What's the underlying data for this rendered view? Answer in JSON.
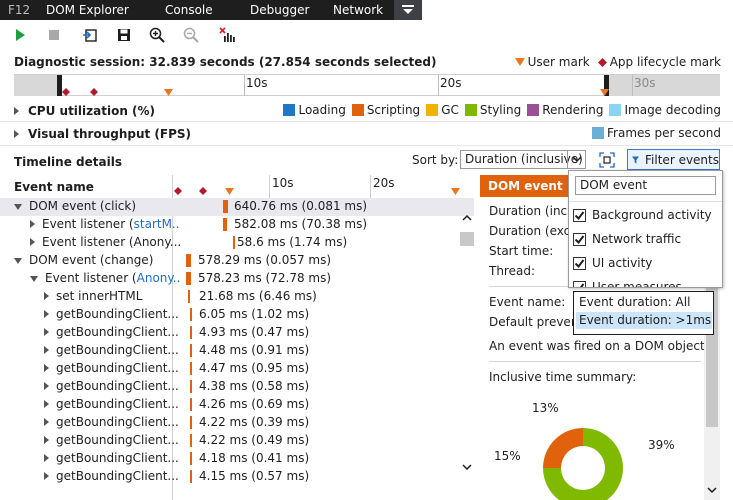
{
  "tabs": {
    "f12": "F12",
    "items": [
      "DOM Explorer",
      "Console",
      "Debugger",
      "Network"
    ]
  },
  "toolbar": {
    "icons": [
      "play-icon",
      "stop-icon",
      "import-icon",
      "save-icon",
      "zoom-in-icon",
      "zoom-out-icon",
      "clear-selection-icon"
    ]
  },
  "session": {
    "text": "Diagnostic session: 32.839 seconds (27.854 seconds selected)",
    "user_mark": "User mark",
    "lifecycle_mark": "App lifecycle mark"
  },
  "overview_ruler": {
    "labels": [
      "10s",
      "20s",
      "30s"
    ]
  },
  "cpu": {
    "title": "CPU utilization (%)",
    "legend": [
      {
        "label": "Loading",
        "color": "#1e78c8"
      },
      {
        "label": "Scripting",
        "color": "#e0620d"
      },
      {
        "label": "GC",
        "color": "#f0b400"
      },
      {
        "label": "Styling",
        "color": "#7fba00"
      },
      {
        "label": "Rendering",
        "color": "#9b4f96"
      },
      {
        "label": "Image decoding",
        "color": "#8cd3f0"
      }
    ]
  },
  "visual": {
    "title": "Visual throughput (FPS)",
    "legend": "Frames per second"
  },
  "details": {
    "title": "Timeline details",
    "sort_label": "Sort by:",
    "sort_value": "Duration (inclusive)",
    "filter_label": "Filter events"
  },
  "list": {
    "header": "Event name",
    "ruler_labels": [
      "10s",
      "20s"
    ],
    "rows": [
      {
        "name": "DOM event (click)",
        "value": "640.76 ms (0.081 ms)"
      },
      {
        "name": "Event listener (",
        "link": "startM...",
        "value": "582.08 ms (70.38 ms)"
      },
      {
        "name": "Event listener (Anony...",
        "value": "58.6 ms (1.74 ms)"
      },
      {
        "name": "DOM event (change)",
        "value": "578.29 ms (0.057 ms)"
      },
      {
        "name": "Event listener (",
        "link": "Anony...",
        "value": "578.23 ms (72.78 ms)"
      },
      {
        "name": "set innerHTML",
        "value": "21.68 ms (6.46 ms)"
      },
      {
        "name": "getBoundingClient...",
        "value": "6.05 ms (1.02 ms)"
      },
      {
        "name": "getBoundingClient...",
        "value": "4.93 ms (0.47 ms)"
      },
      {
        "name": "getBoundingClient...",
        "value": "4.48 ms (0.91 ms)"
      },
      {
        "name": "getBoundingClient...",
        "value": "4.47 ms (0.95 ms)"
      },
      {
        "name": "getBoundingClient...",
        "value": "4.38 ms (0.58 ms)"
      },
      {
        "name": "getBoundingClient...",
        "value": "4.26 ms (0.69 ms)"
      },
      {
        "name": "getBoundingClient...",
        "value": "4.22 ms (0.39 ms)"
      },
      {
        "name": "getBoundingClient...",
        "value": "4.22 ms (0.49 ms)"
      },
      {
        "name": "getBoundingClient...",
        "value": "4.18 ms (0.41 ms)"
      },
      {
        "name": "getBoundingClient...",
        "value": "4.15 ms (0.57 ms)"
      }
    ]
  },
  "detail": {
    "title": "DOM event",
    "duration_incl": "Duration (inclu",
    "duration_excl": "Duration (exclu",
    "start_time": "Start time:",
    "thread": "Thread:",
    "event_name": "Event name:",
    "default_prevent": "Default preven",
    "description": "An event was fired on a DOM object.",
    "summary_title": "Inclusive time summary:",
    "pct_top": "13%",
    "pct_right": "39%",
    "pct_left": "15%"
  },
  "filter_popup": {
    "search_value": "DOM event",
    "options": [
      {
        "label": "Background activity",
        "checked": true
      },
      {
        "label": "Network traffic",
        "checked": true
      },
      {
        "label": "UI activity",
        "checked": true
      },
      {
        "label": "User measures",
        "checked": true
      }
    ]
  },
  "duration_dropdown": {
    "options": [
      "Event duration: All",
      "Event duration: >1ms"
    ],
    "highlighted": "Event duration: >1ms"
  }
}
